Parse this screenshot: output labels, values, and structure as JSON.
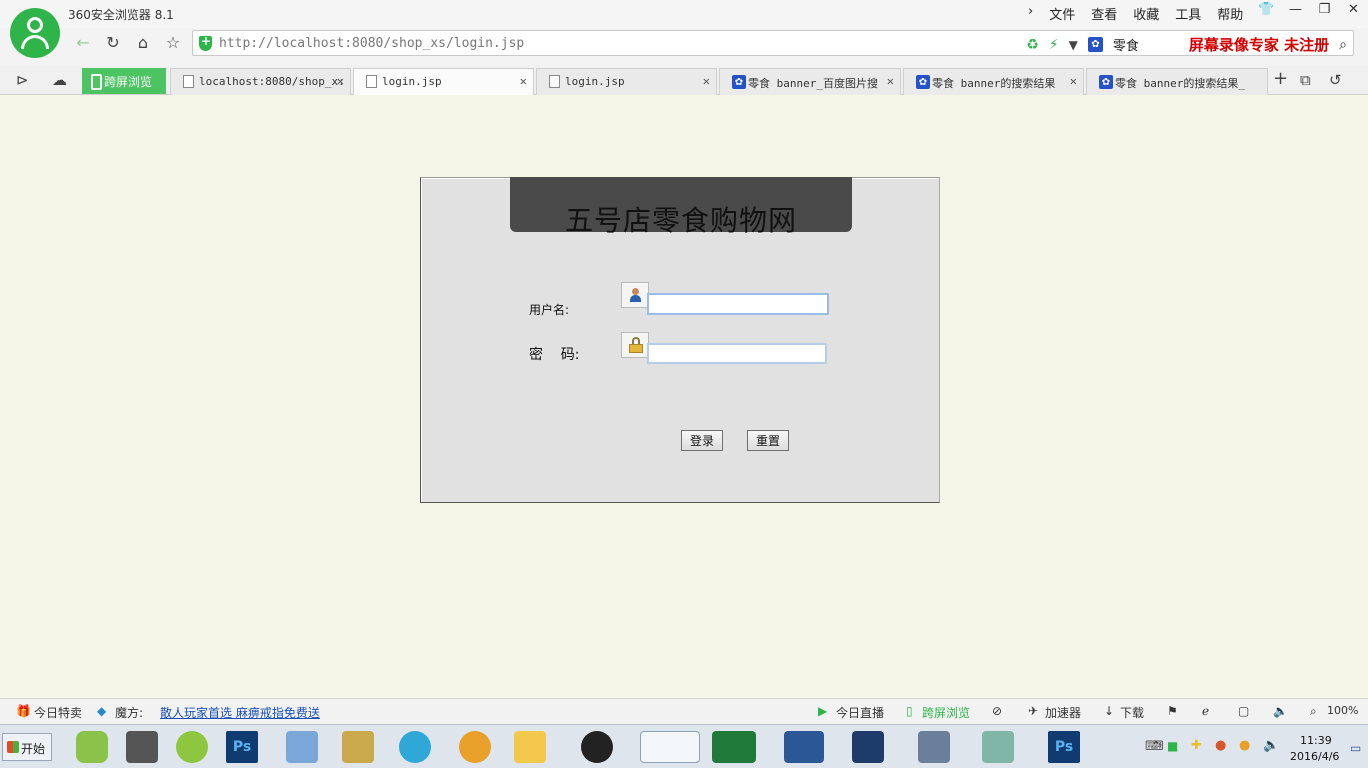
{
  "browser": {
    "app_title": "360安全浏览器 8.1",
    "menu": [
      "文件",
      "查看",
      "收藏",
      "工具",
      "帮助"
    ],
    "window_controls": [
      "👕",
      "—",
      "❐",
      "✕"
    ],
    "url": "http://localhost:8080/shop_xs/login.jsp",
    "search_term": "零食",
    "recorder_text": "屏幕录像专家  未注册"
  },
  "tabs": {
    "cross_screen": "跨屏浏览",
    "items": [
      {
        "title": "localhost:8080/shop_x:",
        "icon": "page-icon"
      },
      {
        "title": "login.jsp",
        "icon": "page-icon",
        "active": true
      },
      {
        "title": "login.jsp",
        "icon": "page-icon"
      },
      {
        "title": "零食 banner_百度图片搜",
        "icon": "baidu-paw-icon"
      },
      {
        "title": "零食 banner的搜索结果",
        "icon": "baidu-paw-icon"
      },
      {
        "title": "零食 banner的搜索结果_",
        "icon": "baidu-paw-icon"
      }
    ]
  },
  "login": {
    "banner_title": "五号店零食购物网",
    "username_label": "用户名:",
    "username_value": "",
    "password_label": "密    码:",
    "password_value": "",
    "login_button": "登录",
    "reset_button": "重置"
  },
  "statusbar": {
    "today_deals": "今日特卖",
    "magic": "魔方:",
    "ad_text": "散人玩家首选 麻痹戒指免费送",
    "today_live": "今日直播",
    "cross_screen": "跨屏浏览",
    "accelerator": "加速器",
    "download": "下载",
    "zoom": "100%"
  },
  "taskbar": {
    "start": "开始",
    "time": "11:39",
    "date": "2016/4/6"
  }
}
